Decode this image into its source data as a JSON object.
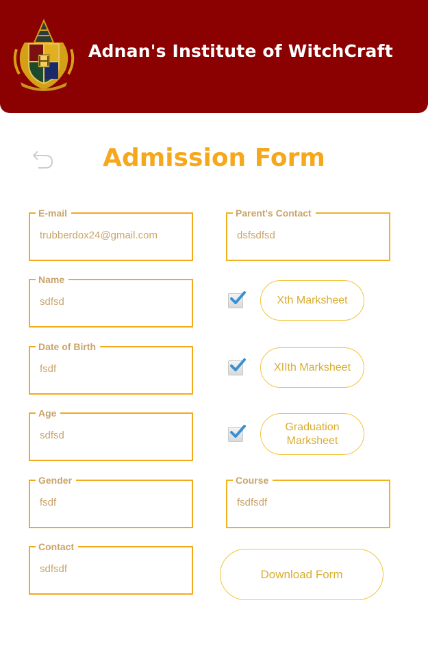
{
  "header": {
    "title": "Adnan's Institute of WitchCraft"
  },
  "page": {
    "title": "Admission Form"
  },
  "fields": {
    "email": {
      "label": "E-mail",
      "value": "trubberdox24@gmail.com"
    },
    "name": {
      "label": "Name",
      "value": "sdfsd"
    },
    "dob": {
      "label": "Date of Birth",
      "value": "fsdf"
    },
    "age": {
      "label": "Age",
      "value": "sdfsd"
    },
    "gender": {
      "label": "Gender",
      "value": "fsdf"
    },
    "contact": {
      "label": "Contact",
      "value": "sdfsdf"
    },
    "parents_contact": {
      "label": "Parent's Contact",
      "value": "dsfsdfsd"
    },
    "course": {
      "label": "Course",
      "value": "fsdfsdf"
    }
  },
  "marksheets": {
    "xth": {
      "label": "Xth Marksheet",
      "checked": true
    },
    "xiith": {
      "label": "XIIth Marksheet",
      "checked": true
    },
    "graduation": {
      "label": "Graduation Marksheet",
      "checked": true
    }
  },
  "actions": {
    "download_label": "Download Form"
  },
  "colors": {
    "header_bg": "#8b0000",
    "accent": "#f5a81c",
    "label": "#c9a46a"
  }
}
